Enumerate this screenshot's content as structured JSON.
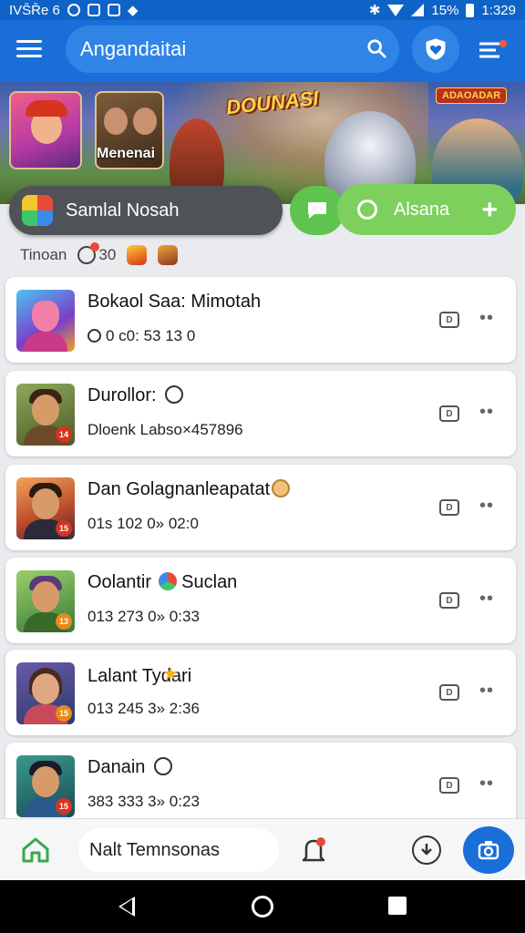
{
  "status_bar": {
    "left_text": "IVS̄R̄e 6",
    "battery": "15%",
    "time": "1:329"
  },
  "app_bar": {
    "search_text": "Angandaitai",
    "icons": [
      "menu-icon",
      "search-icon",
      "heart-shield-icon",
      "filter-icon"
    ]
  },
  "banner": {
    "thumb_caption": "Menenai",
    "title": "DOUNASI",
    "badge": "ADAOADAR"
  },
  "actions": {
    "profile_label": "Samlal Nosah",
    "green_label": "Alsana"
  },
  "tabs": {
    "label": "Tinoan",
    "count": "30"
  },
  "items": [
    {
      "title": "Bokaol Saa: Mimotah",
      "subtitle": "0 c0: 53 13 0",
      "level": "",
      "theme": "purple"
    },
    {
      "title": "Durollor:",
      "subtitle": "Dloenk Labso×457896",
      "level": "14",
      "theme": "olive"
    },
    {
      "title": "Dan Golagnanleapatat",
      "subtitle": "01s 102 0» 02:0",
      "level": "15",
      "theme": "sunset"
    },
    {
      "title": "Oolantir",
      "title_suffix": "Suclan",
      "subtitle": "013 273 0» 0:33",
      "level": "13",
      "theme": "green"
    },
    {
      "title": "Lalant Tydari",
      "subtitle": "013 245 3» 2:36",
      "level": "15",
      "theme": "violet"
    },
    {
      "title": "Danain",
      "subtitle": "383 333 3» 0:23",
      "level": "15",
      "theme": "teal"
    }
  ],
  "bottom_nav": {
    "field_text": "Nalt Temnsonas",
    "icons": [
      "home-icon",
      "bell-icon",
      "download-icon",
      "camera-icon"
    ]
  },
  "colors": {
    "primary": "#1a6ed8",
    "green": "#7ed05d",
    "dark_pill": "#4f5357"
  }
}
